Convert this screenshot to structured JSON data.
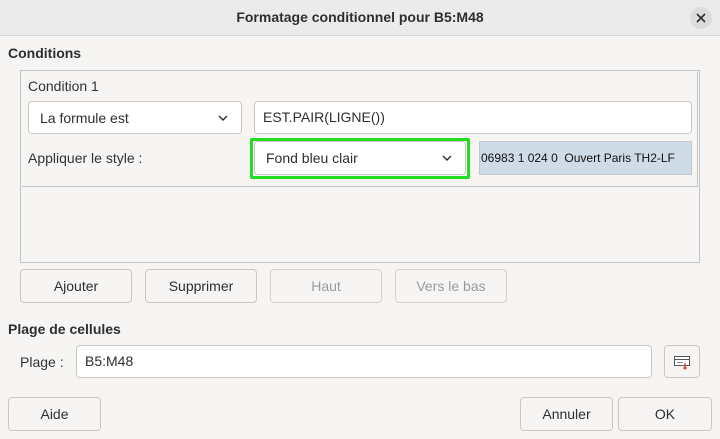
{
  "dialog": {
    "title": "Formatage conditionnel pour B5:M48"
  },
  "conditions": {
    "section_label": "Conditions",
    "condition_title": "Condition 1",
    "type_combo": "La formule est",
    "formula": "EST.PAIR(LIGNE())",
    "apply_style_label": "Appliquer le style :",
    "style_combo": "Fond bleu clair",
    "preview_text": "06983 1 024 0  Ouvert Paris TH2-LF",
    "highlight_color": "#22dd22",
    "preview_color": "#d0dbe8"
  },
  "condition_buttons": {
    "add": "Ajouter",
    "delete": "Supprimer",
    "up": "Haut",
    "down": "Vers le bas"
  },
  "range": {
    "section_label": "Plage de cellules",
    "label": "Plage :",
    "value": "B5:M48"
  },
  "footer": {
    "help": "Aide",
    "cancel": "Annuler",
    "ok": "OK"
  }
}
